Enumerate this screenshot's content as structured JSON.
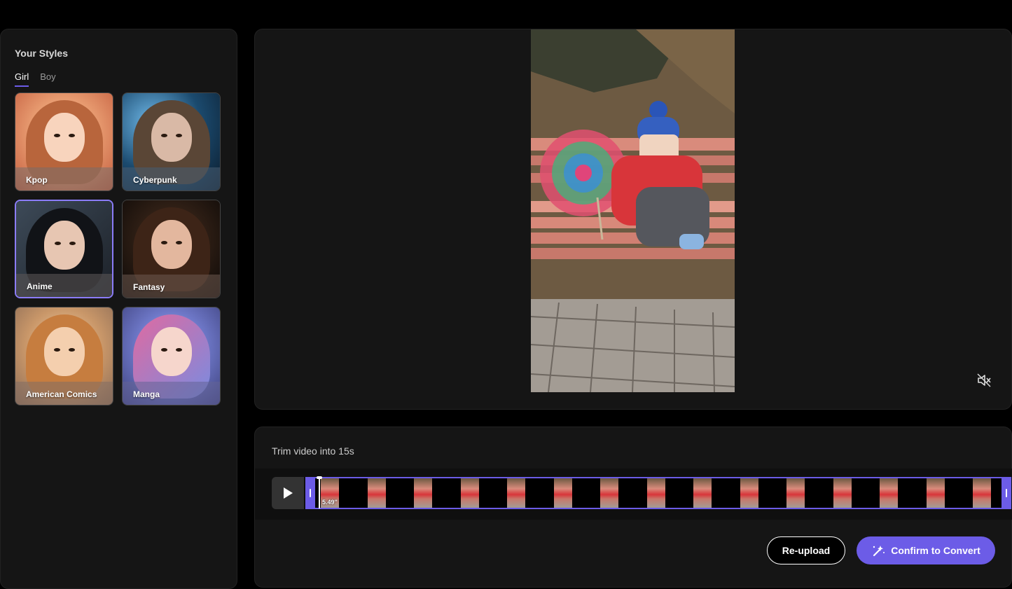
{
  "styles_panel": {
    "title": "Your Styles",
    "tabs": [
      {
        "label": "Girl",
        "active": true
      },
      {
        "label": "Boy",
        "active": false
      }
    ],
    "cards": [
      {
        "label": "Kpop",
        "selected": false
      },
      {
        "label": "Cyberpunk",
        "selected": false
      },
      {
        "label": "Anime",
        "selected": true
      },
      {
        "label": "Fantasy",
        "selected": false
      },
      {
        "label": "American Comics",
        "selected": false
      },
      {
        "label": "Manga",
        "selected": false
      }
    ]
  },
  "video_preview": {
    "mute_icon": "speaker-muted-icon"
  },
  "trim": {
    "label": "Trim video into 15s",
    "current_time": "5.49''",
    "play_icon": "play-icon"
  },
  "actions": {
    "reupload_label": "Re-upload",
    "convert_label": "Confirm to Convert",
    "convert_icon": "magic-wand-icon"
  },
  "colors": {
    "accent": "#6c5ce7",
    "panel_bg": "#151515",
    "page_bg": "#000000"
  }
}
